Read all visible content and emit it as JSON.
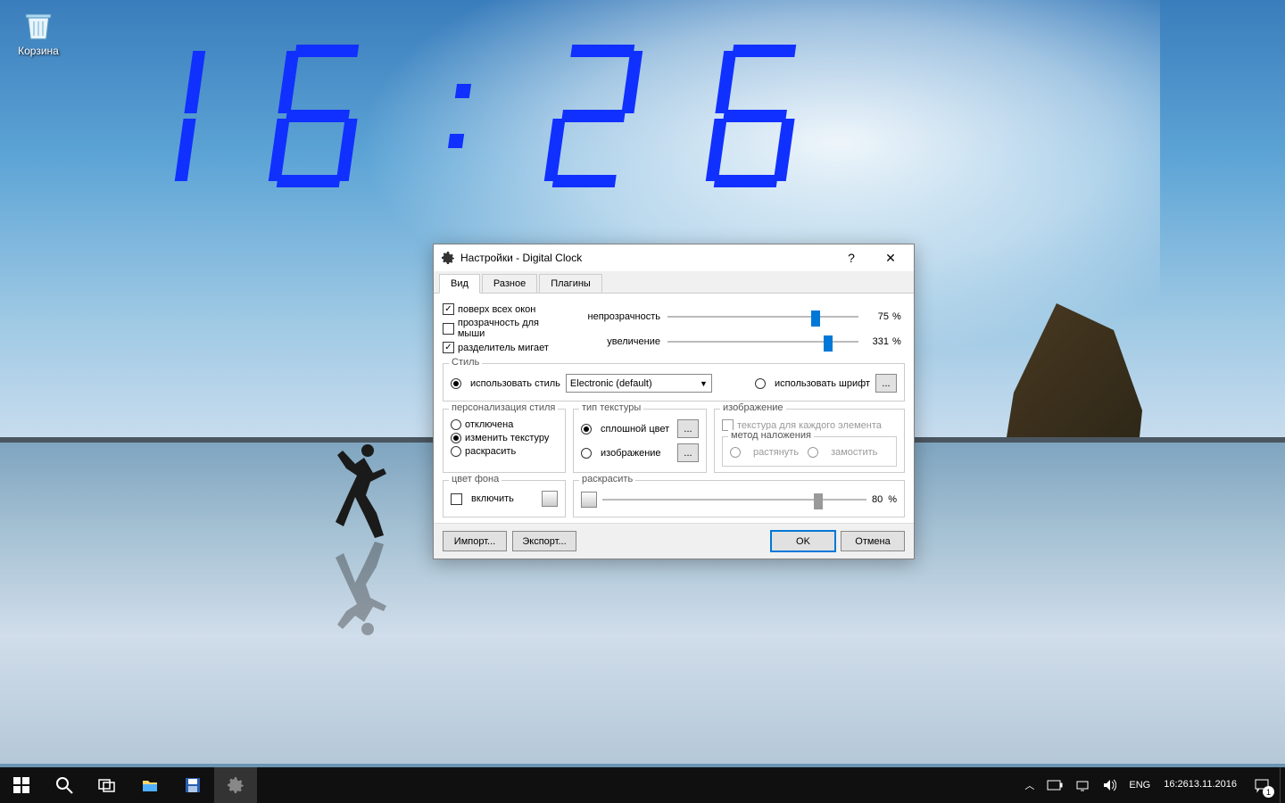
{
  "desktop": {
    "recycle_bin_label": "Корзина",
    "clock_display": "16:26"
  },
  "dialog": {
    "title": "Настройки - Digital Clock",
    "tabs": [
      "Вид",
      "Разное",
      "Плагины"
    ],
    "active_tab": 0,
    "checks": {
      "on_top": {
        "label": "поверх всех окон",
        "checked": true
      },
      "mouse_transparency": {
        "label": "прозрачность для мыши",
        "checked": false
      },
      "separator_blinks": {
        "label": "разделитель мигает",
        "checked": true
      }
    },
    "sliders": {
      "opacity": {
        "label": "непрозрачность",
        "value": 75,
        "unit": "%",
        "pos": 75
      },
      "zoom": {
        "label": "увеличение",
        "value": 331,
        "unit": "%",
        "pos": 82
      }
    },
    "style_group": {
      "legend": "Стиль",
      "use_style": {
        "label": "использовать стиль",
        "selected": true
      },
      "style_select": {
        "value": "Electronic (default)"
      },
      "use_font": {
        "label": "использовать шрифт",
        "selected": false
      },
      "font_button": "..."
    },
    "personalization": {
      "legend": "персонализация стиля",
      "disabled": {
        "label": "отключена",
        "selected": false
      },
      "change_texture": {
        "label": "изменить текстуру",
        "selected": true
      },
      "colorize": {
        "label": "раскрасить",
        "selected": false
      }
    },
    "texture_type": {
      "legend": "тип текстуры",
      "solid_color": {
        "label": "сплошной цвет",
        "selected": true
      },
      "image": {
        "label": "изображение",
        "selected": false
      },
      "button": "..."
    },
    "image_group": {
      "legend": "изображение",
      "per_element": {
        "label": "текстура для каждого элемента",
        "checked": false,
        "disabled": true
      },
      "overlay_legend": "метод наложения",
      "stretch": {
        "label": "растянуть",
        "selected": true,
        "disabled": true
      },
      "tile": {
        "label": "замостить",
        "selected": false,
        "disabled": true
      }
    },
    "bg_color": {
      "legend": "цвет фона",
      "enable": {
        "label": "включить",
        "checked": false
      }
    },
    "colorize_group": {
      "legend": "раскрасить",
      "value": 80,
      "unit": "%",
      "pos": 80
    },
    "buttons": {
      "import": "Импорт...",
      "export": "Экспорт...",
      "ok": "OK",
      "cancel": "Отмена"
    }
  },
  "taskbar": {
    "lang": "ENG",
    "time": "16:26",
    "date": "13.11.2016",
    "notif_count": "1"
  }
}
